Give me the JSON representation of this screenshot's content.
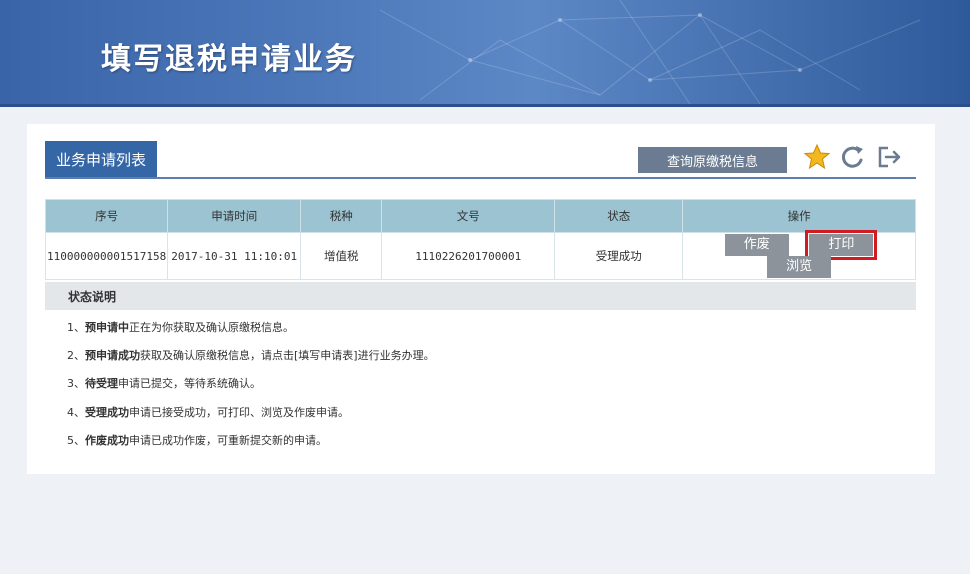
{
  "header": {
    "title": "填写退税申请业务"
  },
  "panel": {
    "tab_label": "业务申请列表",
    "query_button": "查询原缴税信息",
    "icons": [
      "star-icon",
      "refresh-icon",
      "logout-icon"
    ]
  },
  "table": {
    "columns": [
      "序号",
      "申请时间",
      "税种",
      "文号",
      "状态",
      "操作"
    ],
    "rows": [
      {
        "seq": "110000000001517158",
        "time": "2017-10-31 11:10:01",
        "tax": "增值税",
        "doc_no": "1110226201700001",
        "status": "受理成功",
        "actions": [
          "作废",
          "打印",
          "浏览"
        ]
      }
    ]
  },
  "status_help": {
    "title": "状态说明",
    "items": [
      {
        "prefix": "1、",
        "term": "预申请中",
        "desc": "正在为你获取及确认原缴税信息。"
      },
      {
        "prefix": "2、",
        "term": "预申请成功",
        "desc": "获取及确认原缴税信息，请点击[填写申请表]进行业务办理。"
      },
      {
        "prefix": "3、",
        "term": "待受理",
        "desc": "申请已提交，等待系统确认。"
      },
      {
        "prefix": "4、",
        "term": "受理成功",
        "desc": "申请已接受成功，可打印、浏览及作废申请。"
      },
      {
        "prefix": "5、",
        "term": "作废成功",
        "desc": "申请已成功作废，可重新提交新的申请。"
      }
    ]
  },
  "colors": {
    "banner": "#3a64a8",
    "tab": "#3566a6",
    "table_header": "#9cc3d1",
    "highlight": "#d11b22"
  }
}
